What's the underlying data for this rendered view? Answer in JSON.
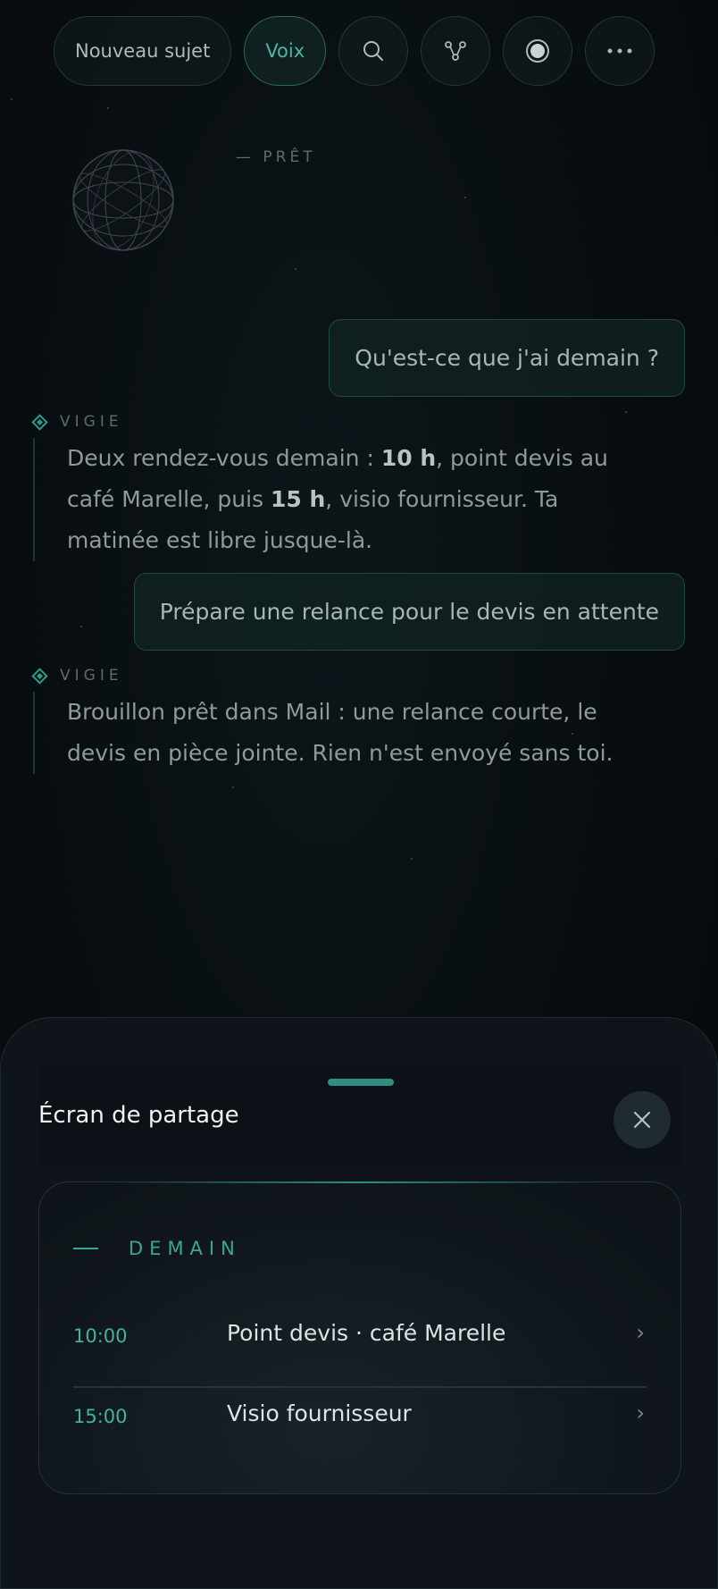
{
  "toolbar": {
    "new_topic_label": "Nouveau sujet",
    "voice_label": "Voix",
    "icons": [
      "search-icon",
      "share-graph-icon",
      "record-icon",
      "more-icon"
    ]
  },
  "status": {
    "text": "— PRÊT"
  },
  "conversation": {
    "user_1": "Qu'est-ce que j'ai demain ?",
    "assistant_name": "VIGIE",
    "assistant_1": {
      "p1": "Deux rendez-vous demain : ",
      "b1": "10 h",
      "p2": ", point devis au café Marelle, puis ",
      "b2": "15 h",
      "p3": ", visio fournisseur. Ta matinée est libre jusque-là."
    },
    "user_2": "Prépare une relance pour le devis en attente",
    "assistant_2": "Brouillon prêt dans Mail : une relance courte, le devis en pièce jointe. Rien n'est envoyé sans toi."
  },
  "sheet": {
    "title": "Écran de partage",
    "section": "DEMAIN",
    "events": [
      {
        "time": "10:00",
        "title": "Point devis · café Marelle"
      },
      {
        "time": "15:00",
        "title": "Visio fournisseur"
      }
    ],
    "chevron": "›"
  },
  "colors": {
    "accent": "#3aa694",
    "background": "#080d10",
    "sheet": "#0e1419"
  }
}
